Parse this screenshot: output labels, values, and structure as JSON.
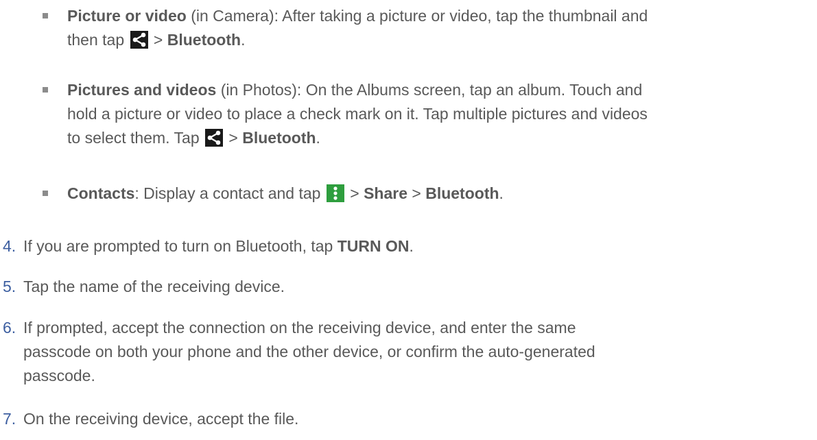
{
  "bullets": [
    {
      "title": "Picture or video",
      "l1_a": " (in Camera): After taking a picture or video, tap the thumbnail and",
      "l2_a": "then tap ",
      "l2_b": " > ",
      "l2_bold": "Bluetooth",
      "l2_end": ".",
      "icon": "share-icon"
    },
    {
      "title": "Pictures and videos",
      "l1_a": " (in Photos): On the Albums screen, tap an album. Touch and",
      "l2": "hold a picture or video to place a check mark on it. Tap multiple pictures and videos",
      "l3_a": "to select them. Tap ",
      "l3_b": " > ",
      "l3_bold": "Bluetooth",
      "l3_end": ".",
      "icon": "share-icon"
    },
    {
      "title": "Contacts",
      "l1_a": ": Display a contact and tap ",
      "l1_b": " > ",
      "share": "Share",
      "l1_c": " > ",
      "bt": "Bluetooth",
      "l1_end": ".",
      "icon": "more-options-icon"
    }
  ],
  "steps": [
    {
      "num": "4.",
      "text_a": "If you are prompted to turn on Bluetooth, tap ",
      "bold": "TURN ON",
      "text_end": "."
    },
    {
      "num": "5.",
      "text": "Tap the name of the receiving device."
    },
    {
      "num": "6.",
      "l1": "If prompted, accept the connection on the receiving device, and enter the same",
      "l2": "passcode on both your phone and the other device, or confirm the auto-generated",
      "l3": "passcode."
    },
    {
      "num": "7.",
      "text": "On the receiving device, accept the file."
    }
  ],
  "colors": {
    "text": "#595959",
    "number": "#3c5ea0",
    "share_icon_bg": "#1a1a1a",
    "more_icon_bg": "#2e9e3e"
  }
}
